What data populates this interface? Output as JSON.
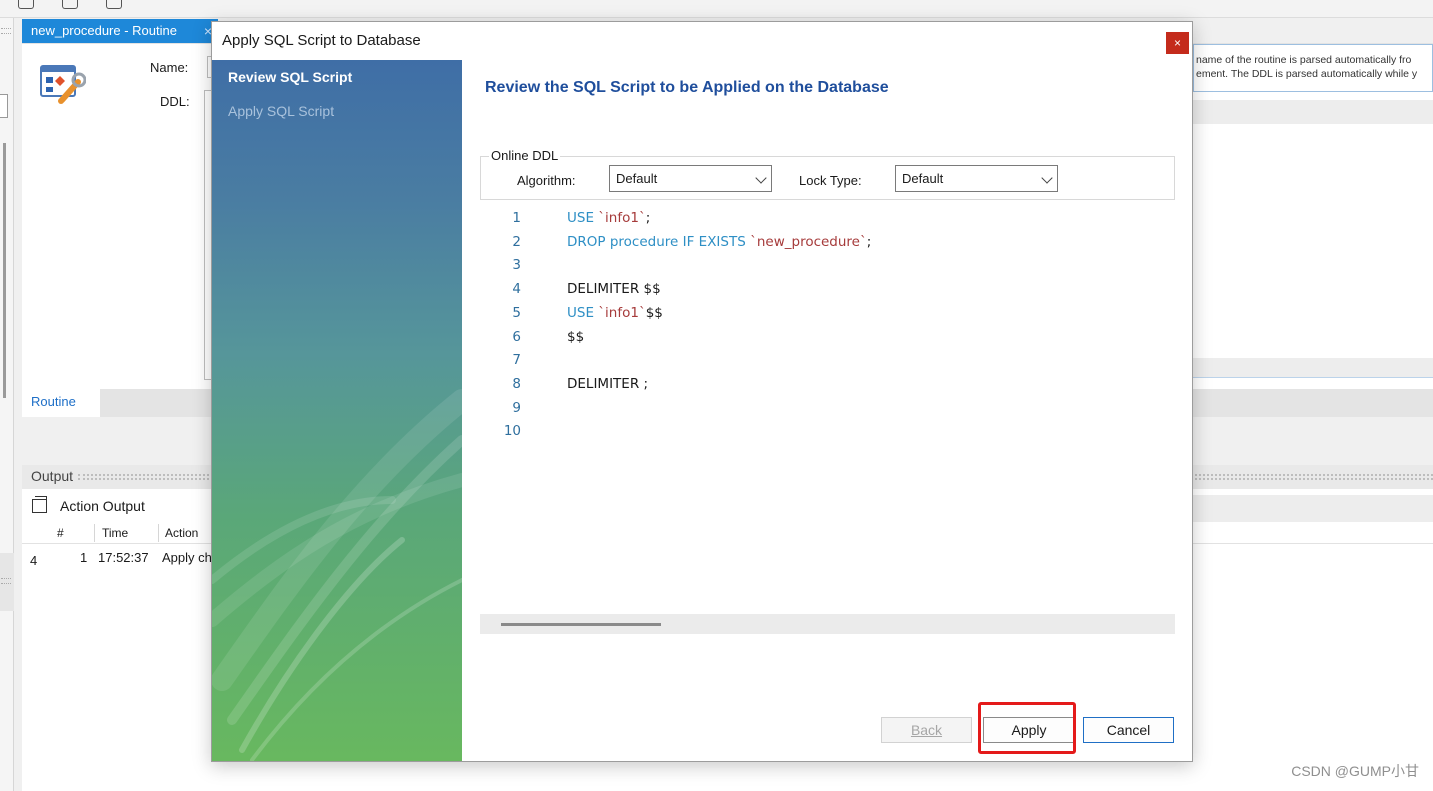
{
  "workbench": {
    "editor_tab_title": "new_procedure - Routine",
    "tab_close_glyph": "×",
    "name_label": "Name:",
    "ddl_label": "DDL:",
    "help_line_1": "name of the routine is parsed automatically fro",
    "help_line_2": "ement. The DDL is parsed automatically while y",
    "routine_tab": "Routine",
    "output_header": "Output",
    "action_output_label": "Action Output",
    "output_columns": [
      "#",
      "Time",
      "Action"
    ],
    "output_row": {
      "marker": "4",
      "index": "1",
      "time": "17:52:37",
      "action": "Apply ch"
    },
    "watermark": "CSDN @GUMP小甘"
  },
  "dialog": {
    "title": "Apply SQL Script to Database",
    "close_glyph": "×",
    "steps": [
      "Review SQL Script",
      "Apply SQL Script"
    ],
    "active_step": 0,
    "heading": "Review the SQL Script to be Applied on the Database",
    "online_ddl": {
      "legend": "Online DDL",
      "algorithm_label": "Algorithm:",
      "algorithm_value": "Default",
      "lock_type_label": "Lock Type:",
      "lock_type_value": "Default"
    },
    "script_lines": [
      {
        "n": "1",
        "parts": [
          {
            "t": "USE ",
            "c": "kw"
          },
          {
            "t": "`info1`",
            "c": "st"
          },
          {
            "t": ";",
            "c": ""
          }
        ]
      },
      {
        "n": "2",
        "parts": [
          {
            "t": "DROP procedure IF EXISTS ",
            "c": "kw"
          },
          {
            "t": "`new_procedure`",
            "c": "st"
          },
          {
            "t": ";",
            "c": ""
          }
        ]
      },
      {
        "n": "3",
        "parts": []
      },
      {
        "n": "4",
        "parts": [
          {
            "t": "DELIMITER $$",
            "c": ""
          }
        ]
      },
      {
        "n": "5",
        "parts": [
          {
            "t": "USE ",
            "c": "kw"
          },
          {
            "t": "`info1`",
            "c": "st"
          },
          {
            "t": "$$",
            "c": ""
          }
        ]
      },
      {
        "n": "6",
        "parts": [
          {
            "t": "$$",
            "c": ""
          }
        ]
      },
      {
        "n": "7",
        "parts": []
      },
      {
        "n": "8",
        "parts": [
          {
            "t": "DELIMITER ;",
            "c": ""
          }
        ]
      },
      {
        "n": "9",
        "parts": []
      },
      {
        "n": "10",
        "parts": []
      }
    ],
    "buttons": {
      "back": "Back",
      "apply": "Apply",
      "cancel": "Cancel"
    },
    "colors": {
      "heading": "#1f4e9c",
      "keyword": "#2e8fc5",
      "string": "#a63b3b",
      "highlight": "#e41a1a"
    }
  }
}
